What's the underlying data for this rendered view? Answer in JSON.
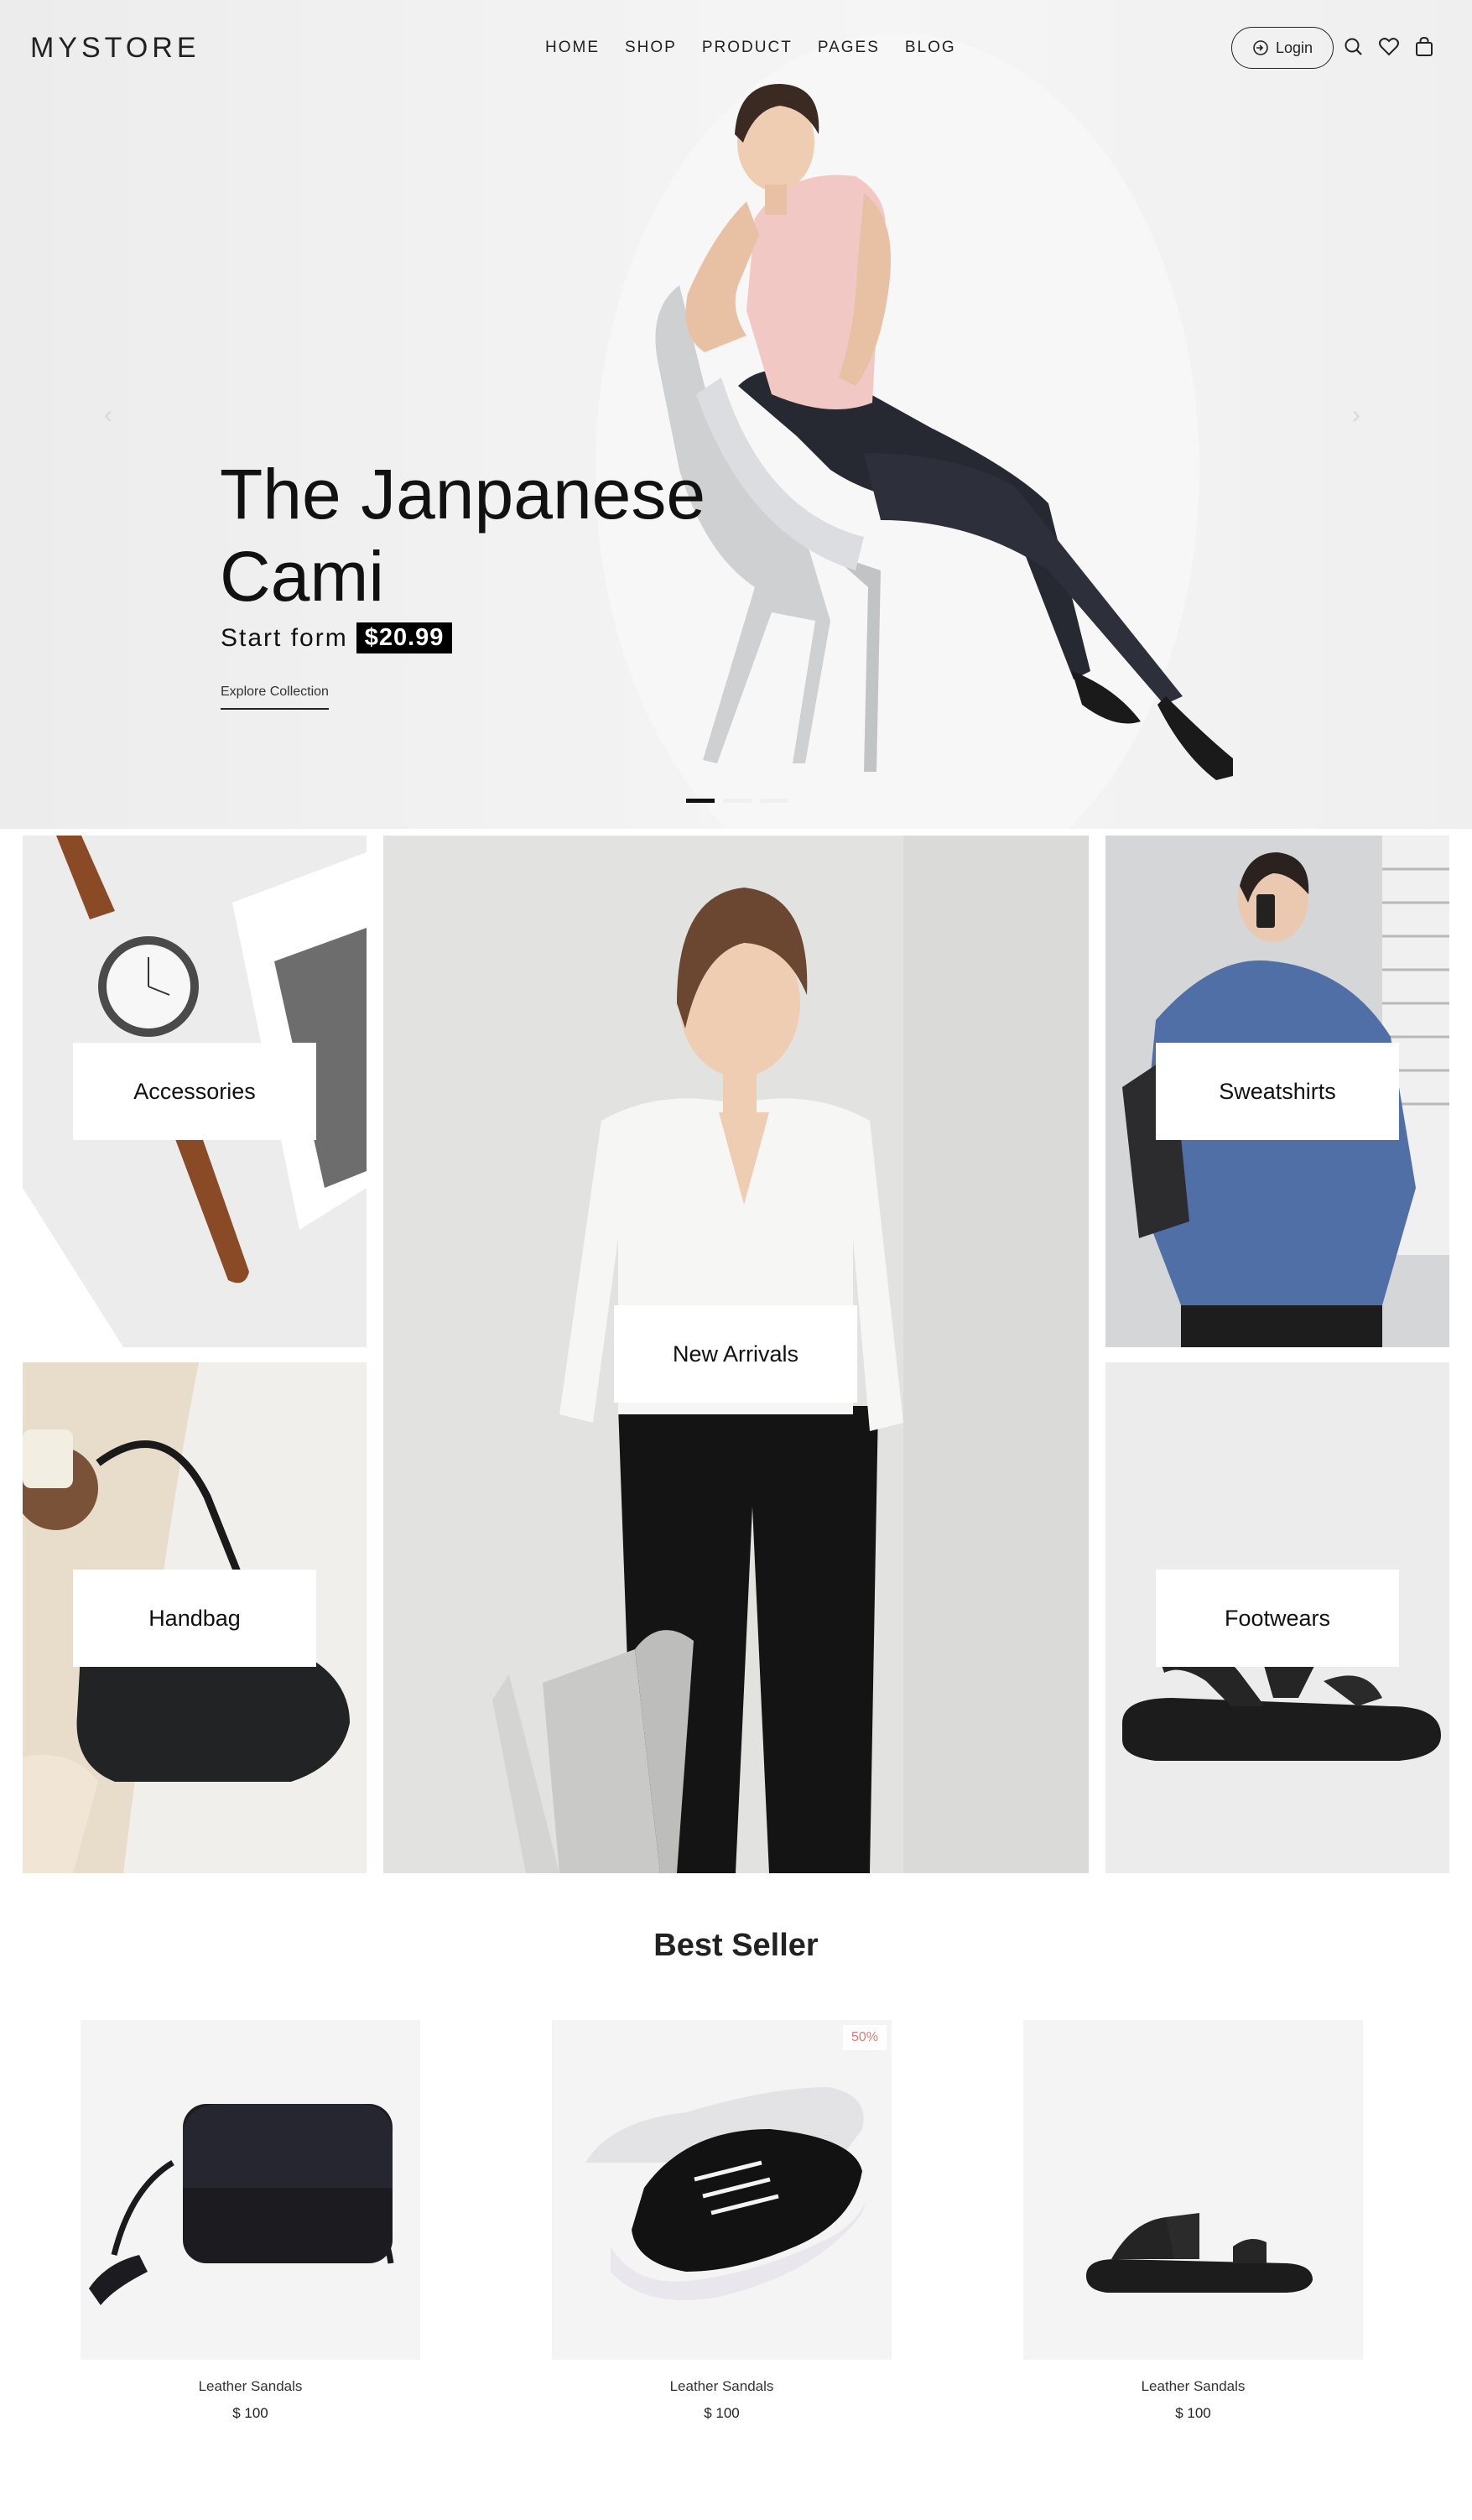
{
  "header": {
    "logo": "MYSTORE",
    "nav": [
      {
        "label": "HOME"
      },
      {
        "label": "SHOP"
      },
      {
        "label": "PRODUCT"
      },
      {
        "label": "PAGES"
      },
      {
        "label": "BLOG"
      }
    ],
    "login_label": "Login",
    "icons": [
      "search-icon",
      "heart-icon",
      "bag-icon"
    ]
  },
  "hero": {
    "title": "The Janpanese Cami",
    "subtitle": "Start form",
    "price": "$20.99",
    "cta": "Explore Collection",
    "prev_arrow": "‹",
    "next_arrow": "›",
    "slide_count": 3,
    "active_slide": 1
  },
  "categories": [
    {
      "label": "Accessories"
    },
    {
      "label": "New Arrivals"
    },
    {
      "label": "Sweatshirts"
    },
    {
      "label": "Handbag"
    },
    {
      "label": "Footwears"
    }
  ],
  "best_seller": {
    "title": "Best Seller",
    "products": [
      {
        "name": "Leather Sandals",
        "price": "$ 100",
        "badge": ""
      },
      {
        "name": "Leather Sandals",
        "price": "$ 100",
        "badge": "50%"
      },
      {
        "name": "Leather Sandals",
        "price": "$ 100",
        "badge": ""
      }
    ]
  },
  "colors": {
    "accent": "#111111",
    "badge_text": "#e07a7a",
    "product_bg": "#f4f4f4"
  }
}
